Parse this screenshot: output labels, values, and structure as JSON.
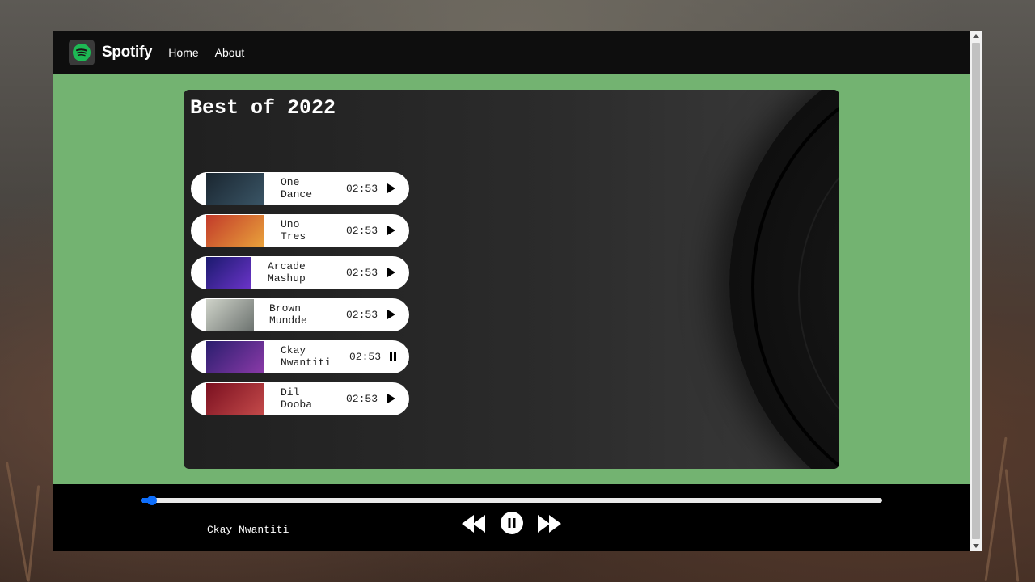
{
  "navbar": {
    "brand": "Spotify",
    "links": [
      "Home",
      "About"
    ]
  },
  "playlist": {
    "title": "Best of 2022",
    "songs": [
      {
        "name_line1": "One",
        "name_line2": "Dance",
        "duration": "02:53",
        "state": "play",
        "thumb_colors": [
          "#1a2630",
          "#3a5566"
        ]
      },
      {
        "name_line1": "Uno",
        "name_line2": "Tres",
        "duration": "02:53",
        "state": "play",
        "thumb_colors": [
          "#c23a2a",
          "#e9a23b"
        ]
      },
      {
        "name_line1": "Arcade",
        "name_line2": "Mashup",
        "duration": "02:53",
        "state": "play",
        "thumb_colors": [
          "#1b1a6e",
          "#6b34c9"
        ]
      },
      {
        "name_line1": "Brown",
        "name_line2": "Mundde",
        "duration": "02:53",
        "state": "play",
        "thumb_colors": [
          "#cfd3c9",
          "#6d7370"
        ]
      },
      {
        "name_line1": "Ckay",
        "name_line2": "Nwantiti",
        "duration": "02:53",
        "state": "pause",
        "thumb_colors": [
          "#2a1e6e",
          "#8a3aa8"
        ]
      },
      {
        "name_line1": "Dil",
        "name_line2": "Dooba",
        "duration": "02:53",
        "state": "play",
        "thumb_colors": [
          "#7a1020",
          "#c44a4a"
        ]
      }
    ]
  },
  "player": {
    "now_playing": "Ckay Nwantiti",
    "progress": 0.015,
    "controls": [
      "previous-icon",
      "pause-icon",
      "next-icon"
    ]
  },
  "colors": {
    "page_bg": "#73b371",
    "navbar_bg": "#0e0e0e",
    "progress_accent": "#0d6efd"
  }
}
